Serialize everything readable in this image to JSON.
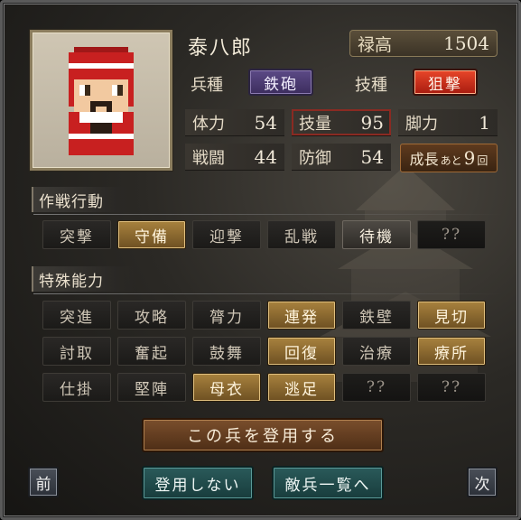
{
  "unit": {
    "name": "泰八郎",
    "stipend_label": "禄高",
    "stipend_value": "1504",
    "troop_type_label": "兵種",
    "troop_type_value": "鉄砲",
    "skill_type_label": "技種",
    "skill_type_value": "狙撃"
  },
  "stats": {
    "stamina_label": "体力",
    "stamina_value": "54",
    "skill_label": "技量",
    "skill_value": "95",
    "legs_label": "脚力",
    "legs_value": "1",
    "combat_label": "戦闘",
    "combat_value": "44",
    "defense_label": "防御",
    "defense_value": "54",
    "growth_a": "成長",
    "growth_b": "あと",
    "growth_c": "9",
    "growth_d": "回"
  },
  "tactics": {
    "title": "作戦行動",
    "items": [
      "突撃",
      "守備",
      "迎撃",
      "乱戦",
      "待機",
      "??"
    ]
  },
  "abilities": {
    "title": "特殊能力",
    "row1": [
      "突進",
      "攻略",
      "膂力",
      "連発",
      "鉄壁",
      "見切"
    ],
    "row2": [
      "討取",
      "奮起",
      "鼓舞",
      "回復",
      "治療",
      "療所"
    ],
    "row3": [
      "仕掛",
      "堅陣",
      "母衣",
      "逃足",
      "??",
      "??"
    ]
  },
  "actions": {
    "recruit": "この兵を登用する",
    "decline": "登用しない",
    "enemy_list": "敵兵一覧へ",
    "prev": "前",
    "next": "次"
  },
  "colors": {
    "active_gold": "#a8823e",
    "troop_purple": "#5c4a86",
    "skill_red": "#e8462a",
    "teal": "#2a5a5a",
    "recruit_brown": "#7a4e2c"
  }
}
